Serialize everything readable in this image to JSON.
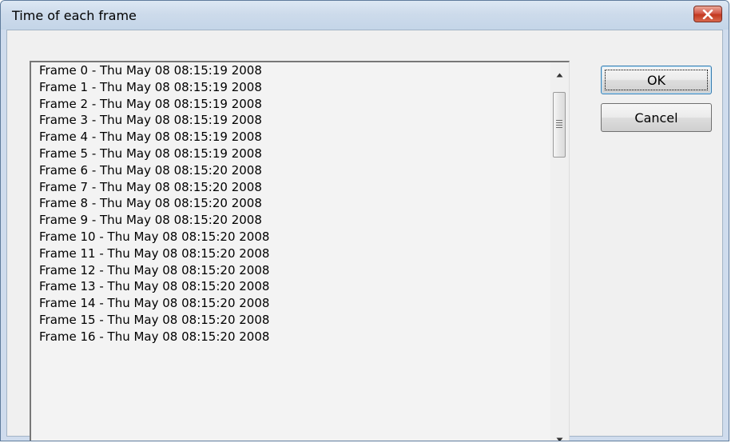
{
  "window": {
    "title": "Time of each frame"
  },
  "list": {
    "items": [
      "Frame 0 - Thu May 08 08:15:19 2008",
      "Frame 1 - Thu May 08 08:15:19 2008",
      "Frame 2 - Thu May 08 08:15:19 2008",
      "Frame 3 - Thu May 08 08:15:19 2008",
      "Frame 4 - Thu May 08 08:15:19 2008",
      "Frame 5 - Thu May 08 08:15:19 2008",
      "Frame 6 - Thu May 08 08:15:20 2008",
      "Frame 7 - Thu May 08 08:15:20 2008",
      "Frame 8 - Thu May 08 08:15:20 2008",
      "Frame 9 - Thu May 08 08:15:20 2008",
      "Frame 10 - Thu May 08 08:15:20 2008",
      "Frame 11 - Thu May 08 08:15:20 2008",
      "Frame 12 - Thu May 08 08:15:20 2008",
      "Frame 13 - Thu May 08 08:15:20 2008",
      "Frame 14 - Thu May 08 08:15:20 2008",
      "Frame 15 - Thu May 08 08:15:20 2008",
      "Frame 16 - Thu May 08 08:15:20 2008"
    ]
  },
  "buttons": {
    "ok_label": "OK",
    "cancel_label": "Cancel"
  },
  "icons": {
    "close": "close-icon",
    "scroll_up": "arrow-up-icon",
    "scroll_down": "arrow-down-icon",
    "thumb_grip": "grip-icon"
  },
  "colors": {
    "close_button": "#c9432f",
    "title_bar": "#cddbeb",
    "dialog_background": "#f0f0f0",
    "ok_border": "#3c7fb1"
  }
}
